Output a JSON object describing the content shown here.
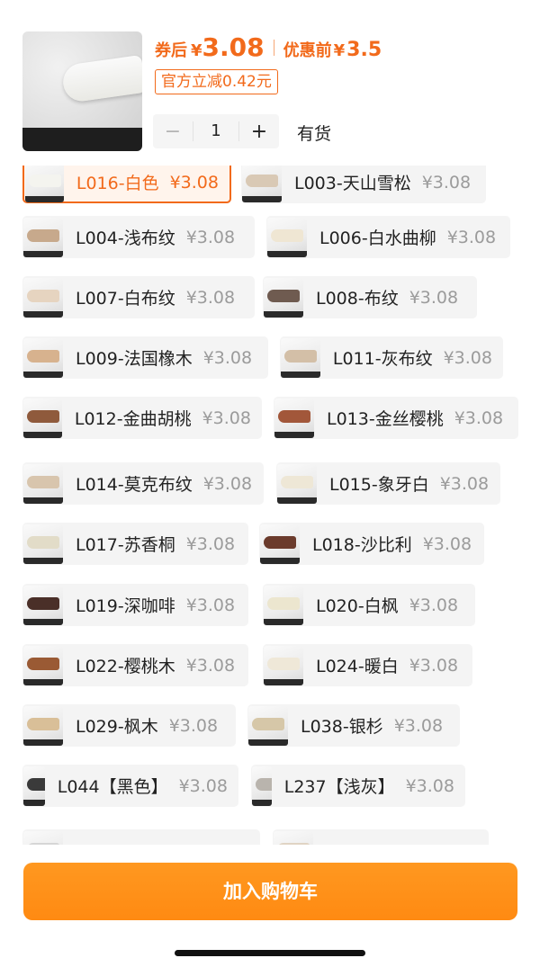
{
  "header": {
    "coupon_label": "券后",
    "currency": "¥",
    "coupon_price": "3.08",
    "before_label": "优惠前",
    "before_price": "3.5",
    "discount_badge": "官方立减0.42元",
    "quantity": "1",
    "minus": "−",
    "plus": "+",
    "stock_status": "有货"
  },
  "options": [
    {
      "name": "L016-白色",
      "price": "¥3.08",
      "selected": true,
      "stick_color": "#f4f4ef"
    },
    {
      "name": "L003-天山雪松",
      "price": "¥3.08",
      "selected": false,
      "stick_color": "#d9c9b5"
    },
    {
      "name": "L004-浅布纹",
      "price": "¥3.08",
      "selected": false,
      "stick_color": "#c7a98c"
    },
    {
      "name": "L006-白水曲柳",
      "price": "¥3.08",
      "selected": false,
      "stick_color": "#efe6d3"
    },
    {
      "name": "L007-白布纹",
      "price": "¥3.08",
      "selected": false,
      "stick_color": "#e6d4c0"
    },
    {
      "name": "L008-布纹",
      "price": "¥3.08",
      "selected": false,
      "stick_color": "#6f5b50"
    },
    {
      "name": "L009-法国橡木",
      "price": "¥3.08",
      "selected": false,
      "stick_color": "#d7b28e"
    },
    {
      "name": "L011-灰布纹",
      "price": "¥3.08",
      "selected": false,
      "stick_color": "#d3bfa7"
    },
    {
      "name": "L012-金曲胡桃",
      "price": "¥3.08",
      "selected": false,
      "stick_color": "#8f5a3c"
    },
    {
      "name": "L013-金丝樱桃",
      "price": "¥3.08",
      "selected": false,
      "stick_color": "#a2573a"
    },
    {
      "name": "L014-莫克布纹",
      "price": "¥3.08",
      "selected": false,
      "stick_color": "#d8c5ad"
    },
    {
      "name": "L015-象牙白",
      "price": "¥3.08",
      "selected": false,
      "stick_color": "#eee7d6"
    },
    {
      "name": "L017-苏香桐",
      "price": "¥3.08",
      "selected": false,
      "stick_color": "#e2dcc8"
    },
    {
      "name": "L018-沙比利",
      "price": "¥3.08",
      "selected": false,
      "stick_color": "#6b3b2c"
    },
    {
      "name": "L019-深咖啡",
      "price": "¥3.08",
      "selected": false,
      "stick_color": "#4a2f28"
    },
    {
      "name": "L020-白枫",
      "price": "¥3.08",
      "selected": false,
      "stick_color": "#ece6cf"
    },
    {
      "name": "L022-樱桃木",
      "price": "¥3.08",
      "selected": false,
      "stick_color": "#9a5a34"
    },
    {
      "name": "L024-暖白",
      "price": "¥3.08",
      "selected": false,
      "stick_color": "#efe8d8"
    },
    {
      "name": "L029-枫木",
      "price": "¥3.08",
      "selected": false,
      "stick_color": "#d9bf98"
    },
    {
      "name": "L038-银杉",
      "price": "¥3.08",
      "selected": false,
      "stick_color": "#d6c7a8"
    },
    {
      "name": "L044【黑色】",
      "price": "¥3.08",
      "selected": false,
      "stick_color": "#3a3a3a"
    },
    {
      "name": "L237【浅灰】",
      "price": "¥3.08",
      "selected": false,
      "stick_color": "#b9b4ad"
    },
    {
      "name": "",
      "price": "",
      "selected": false,
      "stick_color": "#d6d6d6"
    },
    {
      "name": "",
      "price": "",
      "selected": false,
      "stick_color": "#e0d4c4"
    }
  ],
  "cart_button": "加入购物车",
  "colors": {
    "accent": "#f26a1b",
    "button": "#ff9019"
  }
}
